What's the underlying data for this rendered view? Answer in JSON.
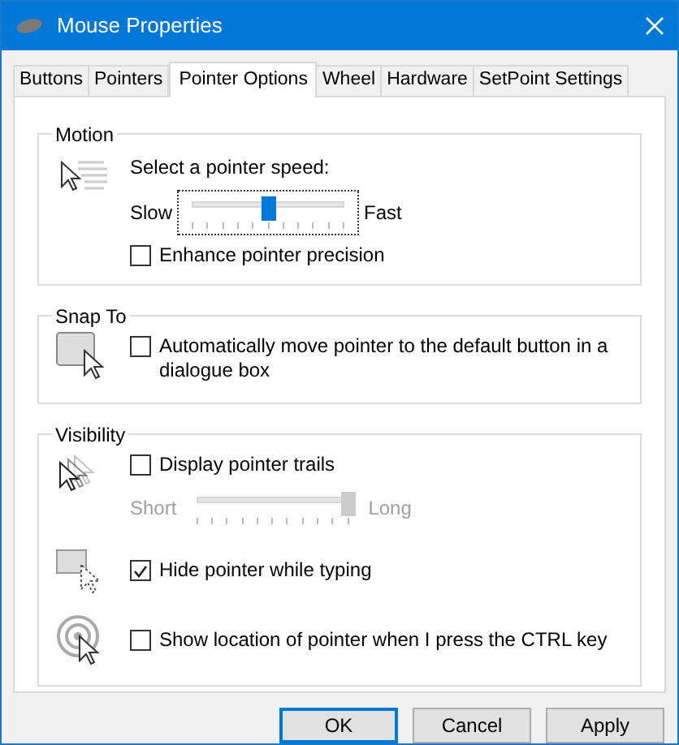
{
  "window": {
    "title": "Mouse Properties"
  },
  "tabs": [
    {
      "label": "Buttons",
      "selected": false
    },
    {
      "label": "Pointers",
      "selected": false
    },
    {
      "label": "Pointer Options",
      "selected": true
    },
    {
      "label": "Wheel",
      "selected": false
    },
    {
      "label": "Hardware",
      "selected": false
    },
    {
      "label": "SetPoint Settings",
      "selected": false
    }
  ],
  "groups": [
    {
      "title": "Motion",
      "rows": [
        {
          "kind": "label",
          "text": "Select a pointer speed:"
        },
        {
          "kind": "slider",
          "min_label": "Slow",
          "max_label": "Fast",
          "level": 0.5,
          "disabled": false
        },
        {
          "kind": "checkbox",
          "label": "Enhance pointer precision",
          "checked": false
        }
      ]
    },
    {
      "title": "Snap To",
      "rows": [
        {
          "kind": "checkbox",
          "label": "Automatically move pointer to the default button in a dialogue box",
          "checked": false
        }
      ]
    },
    {
      "title": "Visibility",
      "rows": [
        {
          "kind": "checkbox",
          "label": "Display pointer trails",
          "checked": false
        },
        {
          "kind": "slider",
          "min_label": "Short",
          "max_label": "Long",
          "level": 1,
          "disabled": true
        },
        {
          "kind": "checkbox",
          "label": "Hide pointer while typing",
          "checked": true
        },
        {
          "kind": "checkbox",
          "label": "Show location of pointer when I press the CTRL key",
          "checked": false
        }
      ]
    }
  ],
  "buttons": [
    {
      "label": "OK",
      "default": true
    },
    {
      "label": "Cancel",
      "default": false
    },
    {
      "label": "Apply",
      "default": false
    }
  ]
}
